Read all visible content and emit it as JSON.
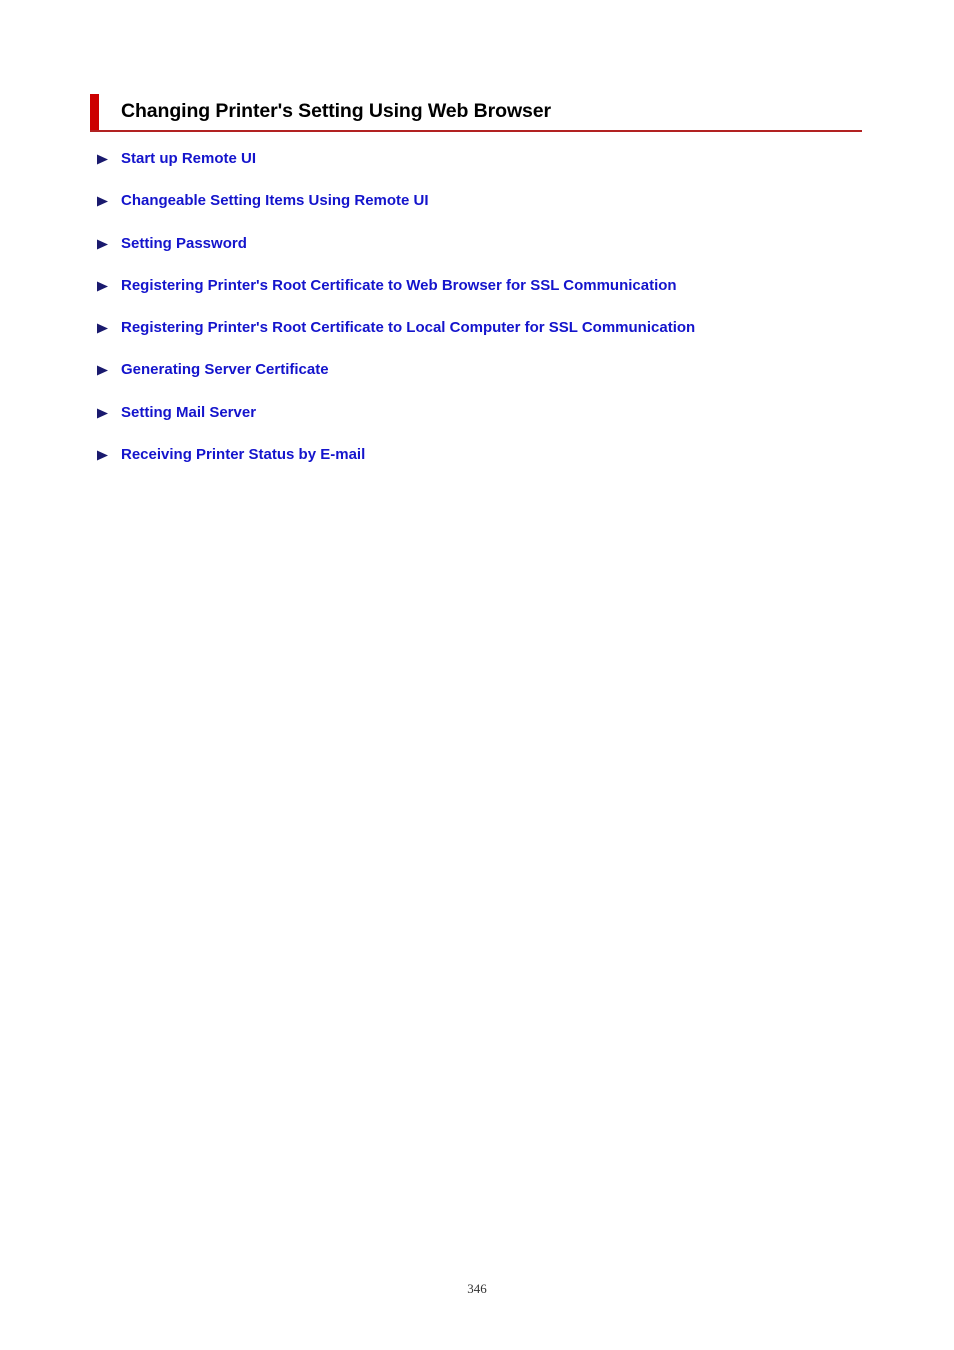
{
  "document": {
    "page_number": "346"
  },
  "heading": {
    "title": "Changing Printer's Setting Using Web Browser",
    "accent_color": "#cc0000",
    "rule_color": "#b22222"
  },
  "link_list": {
    "bullet_icon": "triangle-right-icon",
    "link_color": "#1414cc",
    "items": [
      {
        "label": "Start up Remote UI"
      },
      {
        "label": "Changeable Setting Items Using Remote UI"
      },
      {
        "label": "Setting Password"
      },
      {
        "label": "Registering Printer's Root Certificate to Web Browser for SSL Communication"
      },
      {
        "label": "Registering Printer's Root Certificate to Local Computer for SSL Communication"
      },
      {
        "label": "Generating Server Certificate"
      },
      {
        "label": "Setting Mail Server"
      },
      {
        "label": "Receiving Printer Status by E-mail"
      }
    ]
  }
}
